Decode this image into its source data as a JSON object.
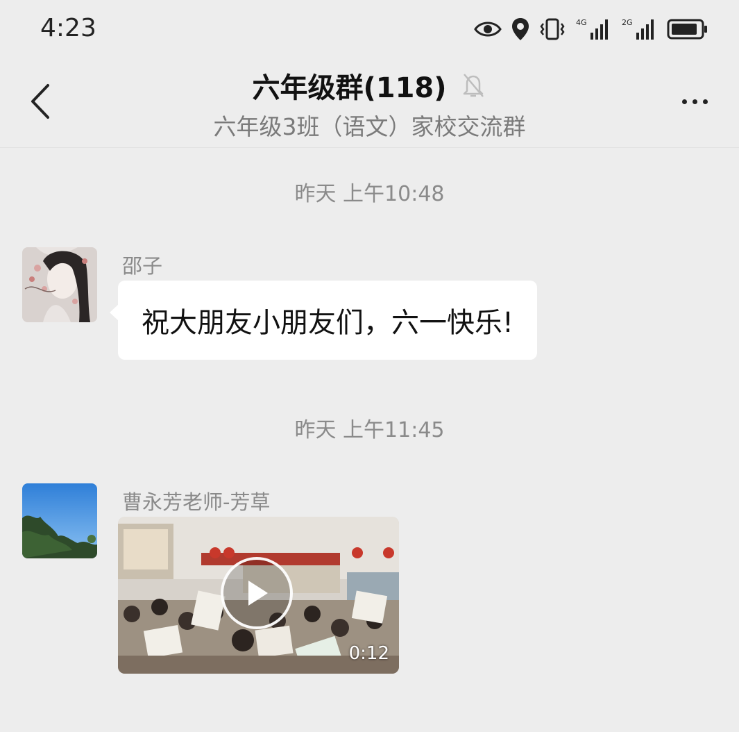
{
  "status_bar": {
    "time": "4:23",
    "network_1": "4G",
    "network_2": "2G",
    "icons": [
      "eye-icon",
      "location-icon",
      "vibrate-icon",
      "signal-4g-icon",
      "signal-2g-icon",
      "battery-icon"
    ]
  },
  "header": {
    "title": "六年级群(118)",
    "subtitle": "六年级3班（语文）家校交流群",
    "muted": true
  },
  "messages": [
    {
      "timestamp": "昨天 上午10:48",
      "sender": "邵子",
      "type": "text",
      "text": "祝大朋友小朋友们，六一快乐!"
    },
    {
      "timestamp": "昨天 上午11:45",
      "sender": "曹永芳老师-芳草",
      "type": "video",
      "duration": "0:12"
    }
  ],
  "colors": {
    "background": "#ededed",
    "bubble": "#ffffff",
    "muted_text": "#8a8a8a"
  }
}
